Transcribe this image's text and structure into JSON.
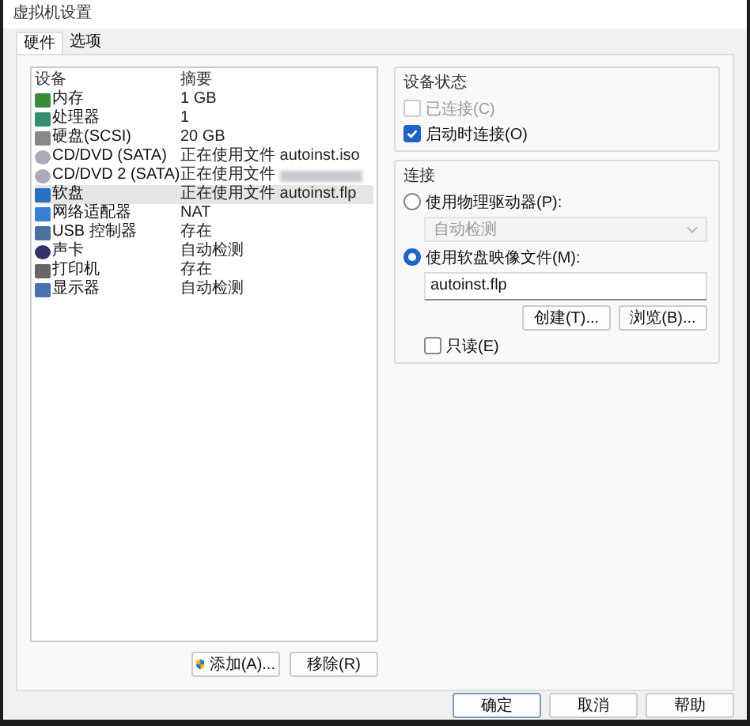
{
  "window": {
    "title": "虚拟机设置"
  },
  "tabs": [
    {
      "label": "硬件",
      "selected": true
    },
    {
      "label": "选项",
      "selected": false
    }
  ],
  "devices": {
    "columns": [
      "设备",
      "摘要"
    ],
    "rows": [
      {
        "kind": "memory",
        "name": "内存",
        "summary": "1 GB",
        "selected": false
      },
      {
        "kind": "cpu",
        "name": "处理器",
        "summary": "1",
        "selected": false
      },
      {
        "kind": "disk",
        "name": "硬盘(SCSI)",
        "summary": "20 GB",
        "selected": false
      },
      {
        "kind": "cd",
        "name": "CD/DVD (SATA)",
        "summary": "正在使用文件 autoinst.iso",
        "selected": false
      },
      {
        "kind": "cd",
        "name": "CD/DVD 2 (SATA)",
        "summary": "正在使用文件",
        "redacted": true,
        "selected": false
      },
      {
        "kind": "floppy",
        "name": "软盘",
        "summary": "正在使用文件 autoinst.flp",
        "selected": true
      },
      {
        "kind": "network",
        "name": "网络适配器",
        "summary": "NAT",
        "selected": false
      },
      {
        "kind": "usb",
        "name": "USB 控制器",
        "summary": "存在",
        "selected": false
      },
      {
        "kind": "sound",
        "name": "声卡",
        "summary": "自动检测",
        "selected": false
      },
      {
        "kind": "printer",
        "name": "打印机",
        "summary": "存在",
        "selected": false
      },
      {
        "kind": "display",
        "name": "显示器",
        "summary": "自动检测",
        "selected": false
      }
    ]
  },
  "list_buttons": [
    "添加(A)...",
    "移除(R)"
  ],
  "device_status": {
    "title": "设备状态",
    "options": [
      {
        "label": "已连接(C)",
        "checked": false,
        "disabled": true
      },
      {
        "label": "启动时连接(O)",
        "checked": true,
        "disabled": false
      }
    ]
  },
  "connection": {
    "title": "连接",
    "physical": {
      "label": "使用物理驱动器(P):",
      "selected": false,
      "dropdown": "自动检测"
    },
    "image": {
      "label": "使用软盘映像文件(M):",
      "selected": true,
      "value": "autoinst.flp"
    },
    "buttons": [
      "创建(T)...",
      "浏览(B)..."
    ],
    "readonly": {
      "label": "只读(E)",
      "checked": false
    }
  },
  "footer_buttons": [
    "确定",
    "取消",
    "帮助"
  ]
}
